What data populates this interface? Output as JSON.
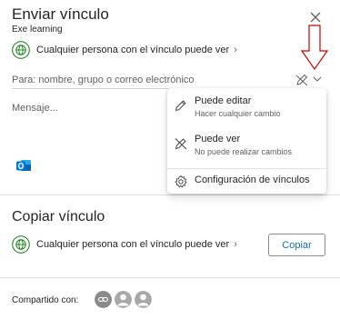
{
  "send_link": {
    "title": "Enviar vínculo",
    "subtitle": "Exe learning",
    "permission_label": "Cualquier persona con el vínculo puede ver",
    "permission_chevron": "›",
    "to_placeholder": "Para: nombre, grupo o correo electrónico",
    "message_placeholder": "Mensaje..."
  },
  "dropdown": {
    "items": [
      {
        "label": "Puede editar",
        "description": "Hacer cualquier cambio",
        "icon": "pencil-icon"
      },
      {
        "label": "Puede ver",
        "description": "No puede realizar cambios",
        "icon": "pencil-slash-icon"
      }
    ],
    "settings_label": "Configuración de vínculos"
  },
  "copy_link": {
    "title": "Copiar vínculo",
    "permission_label": "Cualquier persona con el vínculo puede ver",
    "permission_chevron": "›",
    "copy_button": "Copiar"
  },
  "shared": {
    "label": "Compartido con:"
  },
  "colors": {
    "accent": "#0f6cbd",
    "globe": "#107c10",
    "annotation_arrow": "#cc0000",
    "avatar": "#a8a8a8"
  }
}
